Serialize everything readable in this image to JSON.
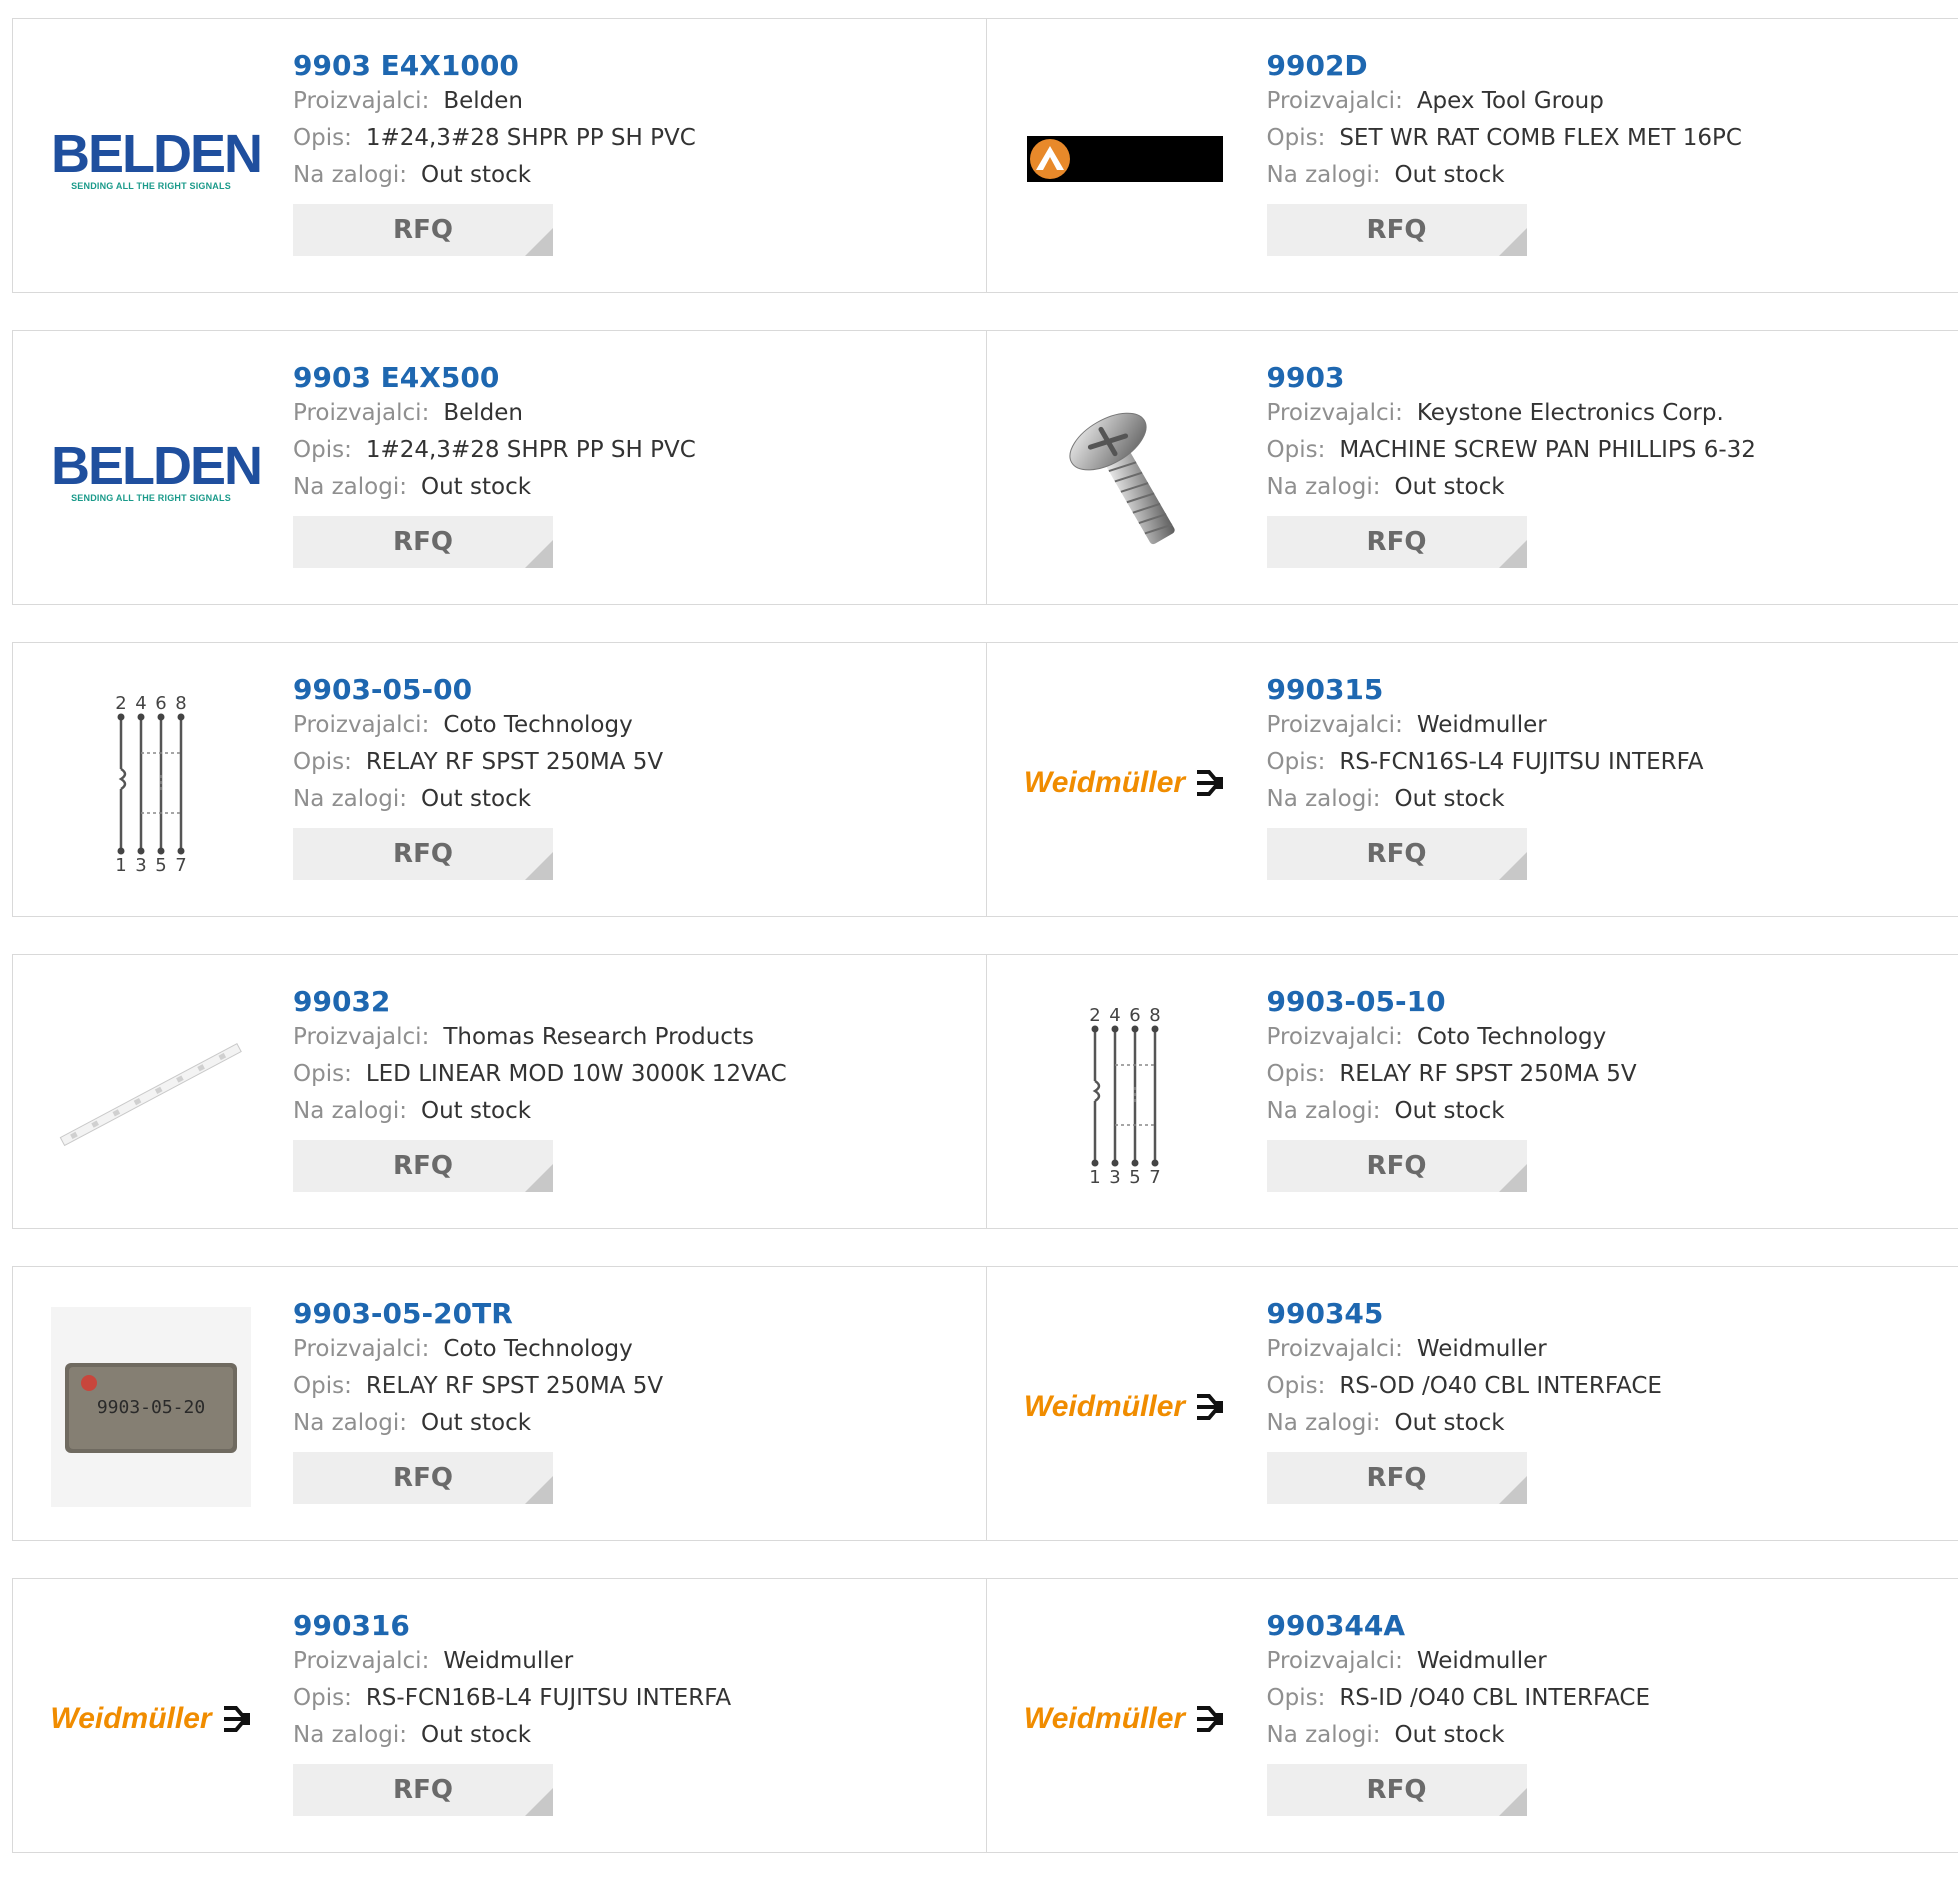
{
  "labels": {
    "manufacturer": "Proizvajalci:",
    "description": "Opis:",
    "stock": "Na zalogi:",
    "rfq": "RFQ"
  },
  "colors": {
    "part_link": "#1e67b0",
    "label_gray": "#8f8f8f",
    "value_text": "#333333",
    "belden_blue": "#1f4f9e",
    "belden_teal": "#1a9a8a",
    "weidmuller_orange": "#f08c00",
    "rfq_bg": "#eeeeee"
  },
  "logos": {
    "belden": {
      "word": "BELDEN",
      "tagline": "SENDING ALL THE RIGHT SIGNALS"
    },
    "weidmuller": {
      "word": "Weidmüller"
    },
    "relay_marking": "9903-05-20",
    "relay_pins_top": [
      "2",
      "4",
      "6",
      "8"
    ],
    "relay_pins_bottom": [
      "1",
      "3",
      "5",
      "7"
    ]
  },
  "products": [
    {
      "part": "9903 E4X1000",
      "manufacturer": "Belden",
      "description": "1#24,3#28 SHPR PP SH PVC",
      "stock": "Out stock",
      "image": "belden-logo"
    },
    {
      "part": "9902D",
      "manufacturer": "Apex Tool Group",
      "description": "SET WR RAT COMB FLEX MET 16PC",
      "stock": "Out stock",
      "image": "apex-logo"
    },
    {
      "part": "9903 E4X500",
      "manufacturer": "Belden",
      "description": "1#24,3#28 SHPR PP SH PVC",
      "stock": "Out stock",
      "image": "belden-logo"
    },
    {
      "part": "9903",
      "manufacturer": "Keystone Electronics Corp.",
      "description": "MACHINE SCREW PAN PHILLIPS 6-32",
      "stock": "Out stock",
      "image": "screw"
    },
    {
      "part": "9903-05-00",
      "manufacturer": "Coto Technology",
      "description": "RELAY RF SPST 250MA 5V",
      "stock": "Out stock",
      "image": "relay-schematic"
    },
    {
      "part": "990315",
      "manufacturer": "Weidmuller",
      "description": "RS-FCN16S-L4 FUJITSU INTERFA",
      "stock": "Out stock",
      "image": "weidmuller-logo"
    },
    {
      "part": "99032",
      "manufacturer": "Thomas Research Products",
      "description": "LED LINEAR MOD 10W 3000K 12VAC",
      "stock": "Out stock",
      "image": "led-strip"
    },
    {
      "part": "9903-05-10",
      "manufacturer": "Coto Technology",
      "description": "RELAY RF SPST 250MA 5V",
      "stock": "Out stock",
      "image": "relay-schematic"
    },
    {
      "part": "9903-05-20TR",
      "manufacturer": "Coto Technology",
      "description": "RELAY RF SPST 250MA 5V",
      "stock": "Out stock",
      "image": "relay-chip"
    },
    {
      "part": "990345",
      "manufacturer": "Weidmuller",
      "description": "RS-OD /O40 CBL INTERFACE",
      "stock": "Out stock",
      "image": "weidmuller-logo"
    },
    {
      "part": "990316",
      "manufacturer": "Weidmuller",
      "description": "RS-FCN16B-L4 FUJITSU INTERFA",
      "stock": "Out stock",
      "image": "weidmuller-logo"
    },
    {
      "part": "990344A",
      "manufacturer": "Weidmuller",
      "description": "RS-ID /O40 CBL INTERFACE",
      "stock": "Out stock",
      "image": "weidmuller-logo"
    }
  ]
}
